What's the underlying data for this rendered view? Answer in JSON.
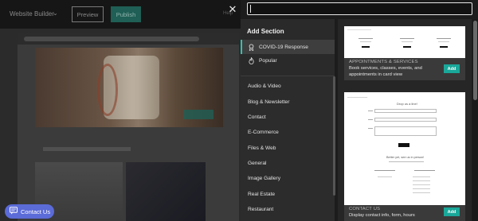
{
  "background": {
    "app_title": "Website Builder",
    "preview_label": "Preview",
    "publish_label": "Publish",
    "help_hint": "Help",
    "contact_button": "Contact Us"
  },
  "panel": {
    "title": "Add Section",
    "search": {
      "value": "",
      "placeholder": ""
    },
    "featured": [
      {
        "label": "COVID-19 Response",
        "icon": "award-ribbon-icon",
        "active": true
      },
      {
        "label": "Popular",
        "icon": "flame-icon",
        "active": false
      }
    ],
    "categories": [
      "Audio & Video",
      "Blog & Newsletter",
      "Contact",
      "E-Commerce",
      "Files & Web",
      "General",
      "Image Gallery",
      "Real Estate",
      "Restaurant"
    ],
    "cards": [
      {
        "label": "APPOINTMENTS & SERVICES",
        "description": "Book services, classes, events, and appointments in card view",
        "add_label": "Add"
      },
      {
        "label": "CONTACT US",
        "description": "Display contact info, form, hours",
        "add_label": "Add",
        "thumb_heading": "Drop us a line!",
        "thumb_subheading": "Better yet, see us in person!"
      }
    ]
  },
  "colors": {
    "accent": "#1aa89a",
    "active_border": "#2dc3b2",
    "contact_button": "#5b6bd8",
    "panel_bg": "#1c1c1c"
  }
}
